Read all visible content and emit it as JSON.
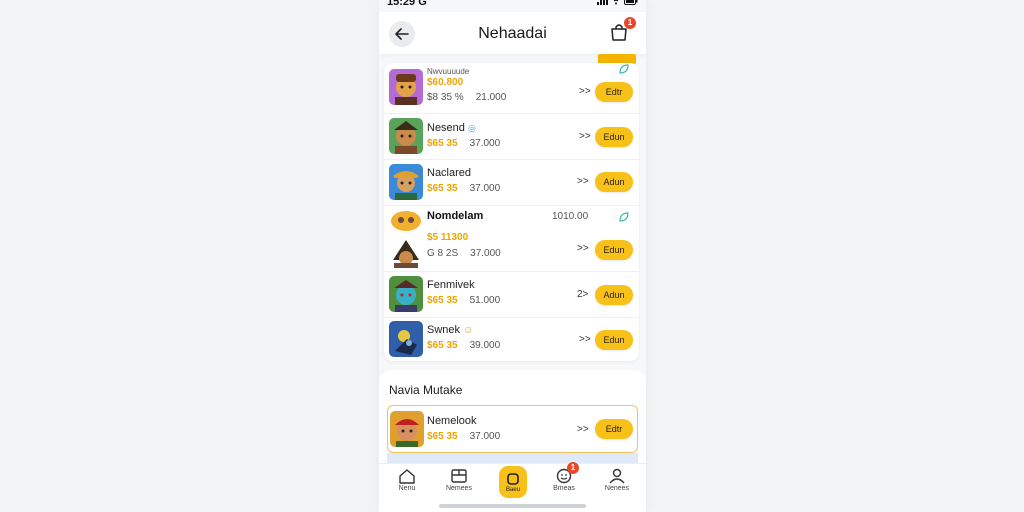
{
  "status": {
    "time": "15:29 G"
  },
  "header": {
    "title": "Nehaadai",
    "cart_badge": "1"
  },
  "list": [
    {
      "kind": "avatar",
      "name": "Nwvuuuude",
      "price": "$60.800",
      "stars": "$8 35 %",
      "value": "21.000",
      "chevron": ">>",
      "action": "Edtr",
      "leaf": true,
      "colors": [
        "#b46bd6",
        "#e3a24a"
      ]
    },
    {
      "kind": "avatar",
      "name": "Nesend",
      "stars": "$65 35",
      "value": "37.000",
      "chevron": ">>",
      "action": "Edun",
      "leaf": false,
      "colors": [
        "#5aa35a",
        "#7a4a2a"
      ]
    },
    {
      "kind": "avatar",
      "name": "Naclared",
      "stars": "$65 35",
      "value": "37.000",
      "chevron": ">>",
      "action": "Adun",
      "leaf": false,
      "colors": [
        "#3a8ad8",
        "#e0a030"
      ]
    },
    {
      "kind": "group",
      "name": "Nomdelam",
      "value_right": "1010.00",
      "price": "$5 11300",
      "stars": "G 8 2S",
      "value": "37.000",
      "chevron": ">>",
      "action": "Edun",
      "leaf": true,
      "colors": [
        "#f3b030",
        "#6a4a3a"
      ]
    },
    {
      "kind": "avatar",
      "name": "Fenmivek",
      "stars": "$65 35",
      "value": "51.000",
      "chevron": "2>",
      "action": "Adun",
      "leaf": false,
      "colors": [
        "#4f8f3e",
        "#3ab0c8"
      ]
    },
    {
      "kind": "avatar",
      "name": "Swnek",
      "stars": "$65 35",
      "value": "39.000",
      "chevron": ">>",
      "action": "Edun",
      "leaf": false,
      "colors": [
        "#2f5fa8",
        "#e5c840"
      ]
    }
  ],
  "section2": {
    "title": "Navia Mutake",
    "item": {
      "name": "Nemelook",
      "stars": "$65 35",
      "value": "37.000",
      "chevron": ">>",
      "action": "Edtr"
    }
  },
  "tabs": [
    {
      "label": "Nenu",
      "icon": "home-icon"
    },
    {
      "label": "Nemees",
      "icon": "book-icon"
    },
    {
      "label": "Baeu",
      "icon": "square-icon",
      "active": true
    },
    {
      "label": "Bmeas",
      "icon": "face-icon",
      "badge": "1"
    },
    {
      "label": "Nenees",
      "icon": "user-icon"
    }
  ],
  "colors": {
    "accent": "#f7c11a",
    "badge": "#e8472a",
    "highlight_border": "#f2c35a"
  }
}
